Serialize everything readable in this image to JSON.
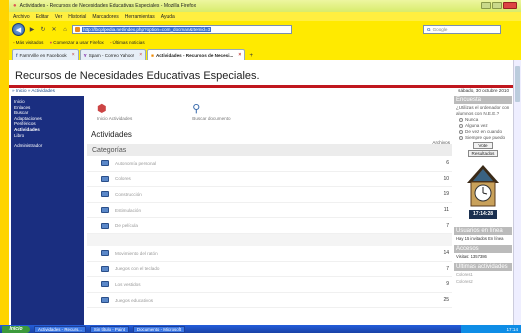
{
  "browser": {
    "window_title": "Actividades - Recursos de Necesidades Educativas Especiales - Mozilla Firefox",
    "menu": [
      "Archivo",
      "Editar",
      "Ver",
      "Historial",
      "Marcadores",
      "Herramientas",
      "Ayuda"
    ],
    "url": "http://lbcplpedia.net/index.php?option=com_docman&Itemid=3",
    "search_placeholder": "Google",
    "bookmarks": [
      "Más visitados",
      "Comenzar a usar Firefox",
      "Últimas noticias"
    ],
    "tabs": [
      {
        "label": "FarmVille en Facebook",
        "active": false
      },
      {
        "label": "Spam - Correo Yahoo!",
        "active": false
      },
      {
        "label": "Actividades - Recursos de Necesi...",
        "active": true
      }
    ]
  },
  "page": {
    "site_title": "Recursos de Necesidades Educativas Especiales.",
    "breadcrumb": "» Inicio » Actividades",
    "date": "sábado, 30 octubre 2010"
  },
  "sidebar": {
    "items": [
      {
        "label": "Inicio",
        "bold": false
      },
      {
        "label": "Enlaces",
        "bold": false
      },
      {
        "label": "Buscar",
        "bold": false
      },
      {
        "label": "Adaptaciones",
        "bold": false
      },
      {
        "label": "Periféricos",
        "bold": false
      },
      {
        "label": "Actividades",
        "bold": true
      },
      {
        "label": "Libro",
        "bold": false
      }
    ],
    "admin_label": "Administrador"
  },
  "main": {
    "icons": [
      {
        "label": "Inicio Actividades"
      },
      {
        "label": "Buscar documento"
      }
    ],
    "section_title": "Actividades",
    "archivos_label": "Archivos",
    "categories_label": "Categorías",
    "rows_group1": [
      {
        "name": "Autonomía personal",
        "count": "6"
      },
      {
        "name": "Colores",
        "count": "10"
      },
      {
        "name": "Construcción",
        "count": "19"
      },
      {
        "name": "Estimulación",
        "count": "11"
      },
      {
        "name": "De película",
        "count": "7"
      }
    ],
    "rows_group2": [
      {
        "name": "Movimiento del ratón",
        "count": "14"
      },
      {
        "name": "Juegos con el teclado",
        "count": "7"
      },
      {
        "name": "Los vestidos",
        "count": "9"
      },
      {
        "name": "Juegos educativos",
        "count": "25"
      }
    ]
  },
  "poll": {
    "heading": "Encuesta",
    "question": "¿Utilizas el ordenador con alumnos con N.E.E.?",
    "options": [
      "Nunca",
      "Alguna vez",
      "De vez en cuando",
      "Siempre que puedo"
    ],
    "vote_label": "Vote",
    "results_label": "Resultados"
  },
  "clock": {
    "time": "17:14:28"
  },
  "stats": {
    "online_heading": "Usuarios en línea",
    "online_text": "Hay 15 invitados En línea",
    "visits_heading": "Accesos",
    "visits_text": "Visitas: 1357386",
    "latest_heading": "Ultimas actividades",
    "latest_items": [
      "Colores1",
      "Colores2"
    ]
  },
  "taskbar": {
    "start_label": "Inicio",
    "tasks": [
      "Actividades - Recurs...",
      "Sin título - Paint",
      "Documento - Microsoft"
    ],
    "tray_time": "17:14"
  },
  "colors": {
    "header_red": "#c0171e",
    "sidebar_blue": "#1a2e80",
    "frame_yellow": "#ffea00"
  }
}
